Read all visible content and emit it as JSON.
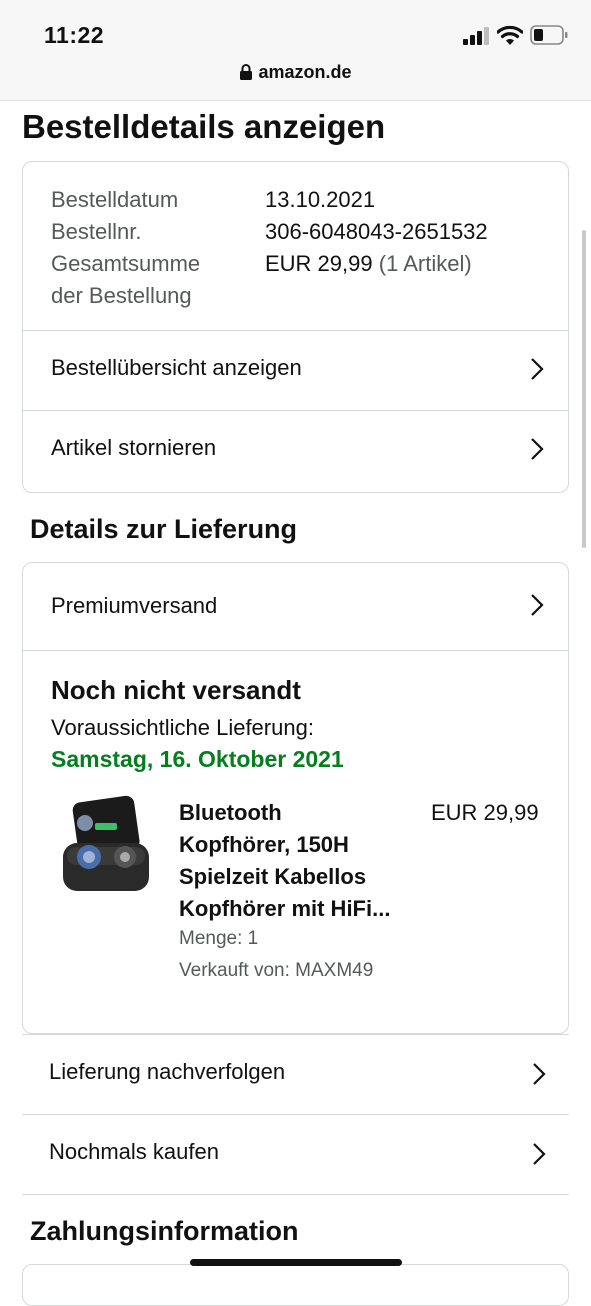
{
  "status_bar": {
    "time": "11:22",
    "url": "amazon.de"
  },
  "page_title": "Bestelldetails anzeigen",
  "order_summary": {
    "date_label": "Bestelldatum",
    "date_value": "13.10.2021",
    "number_label": "Bestellnr.",
    "number_value": "306-6048043-2651532",
    "total_label_line1": "Gesamtsumme",
    "total_label_line2": "der Bestellung",
    "total_value": "EUR 29,99",
    "total_items": "(1 Artikel)",
    "links": [
      "Bestellübersicht anzeigen",
      "Artikel stornieren"
    ]
  },
  "delivery": {
    "heading": "Details zur Lieferung",
    "shipping_method": "Premiumversand",
    "status": "Noch nicht versandt",
    "expected_label": "Voraussichtliche Lieferung:",
    "expected_date": "Samstag, 16. Oktober 2021",
    "product": {
      "title_lines": [
        "Bluetooth",
        "Kopfhörer, 150H",
        "Spielzeit Kabellos",
        "Kopfhörer mit HiFi..."
      ],
      "price": "EUR 29,99",
      "quantity": "Menge: 1",
      "seller": "Verkauft von: MAXM49"
    },
    "actions": [
      "Lieferung nachverfolgen",
      "Nochmals kaufen"
    ]
  },
  "payment": {
    "heading": "Zahlungsinformation"
  },
  "colors": {
    "delivery_date": "#067d1f",
    "border": "#d5d9d9",
    "muted_text": "#565959"
  }
}
